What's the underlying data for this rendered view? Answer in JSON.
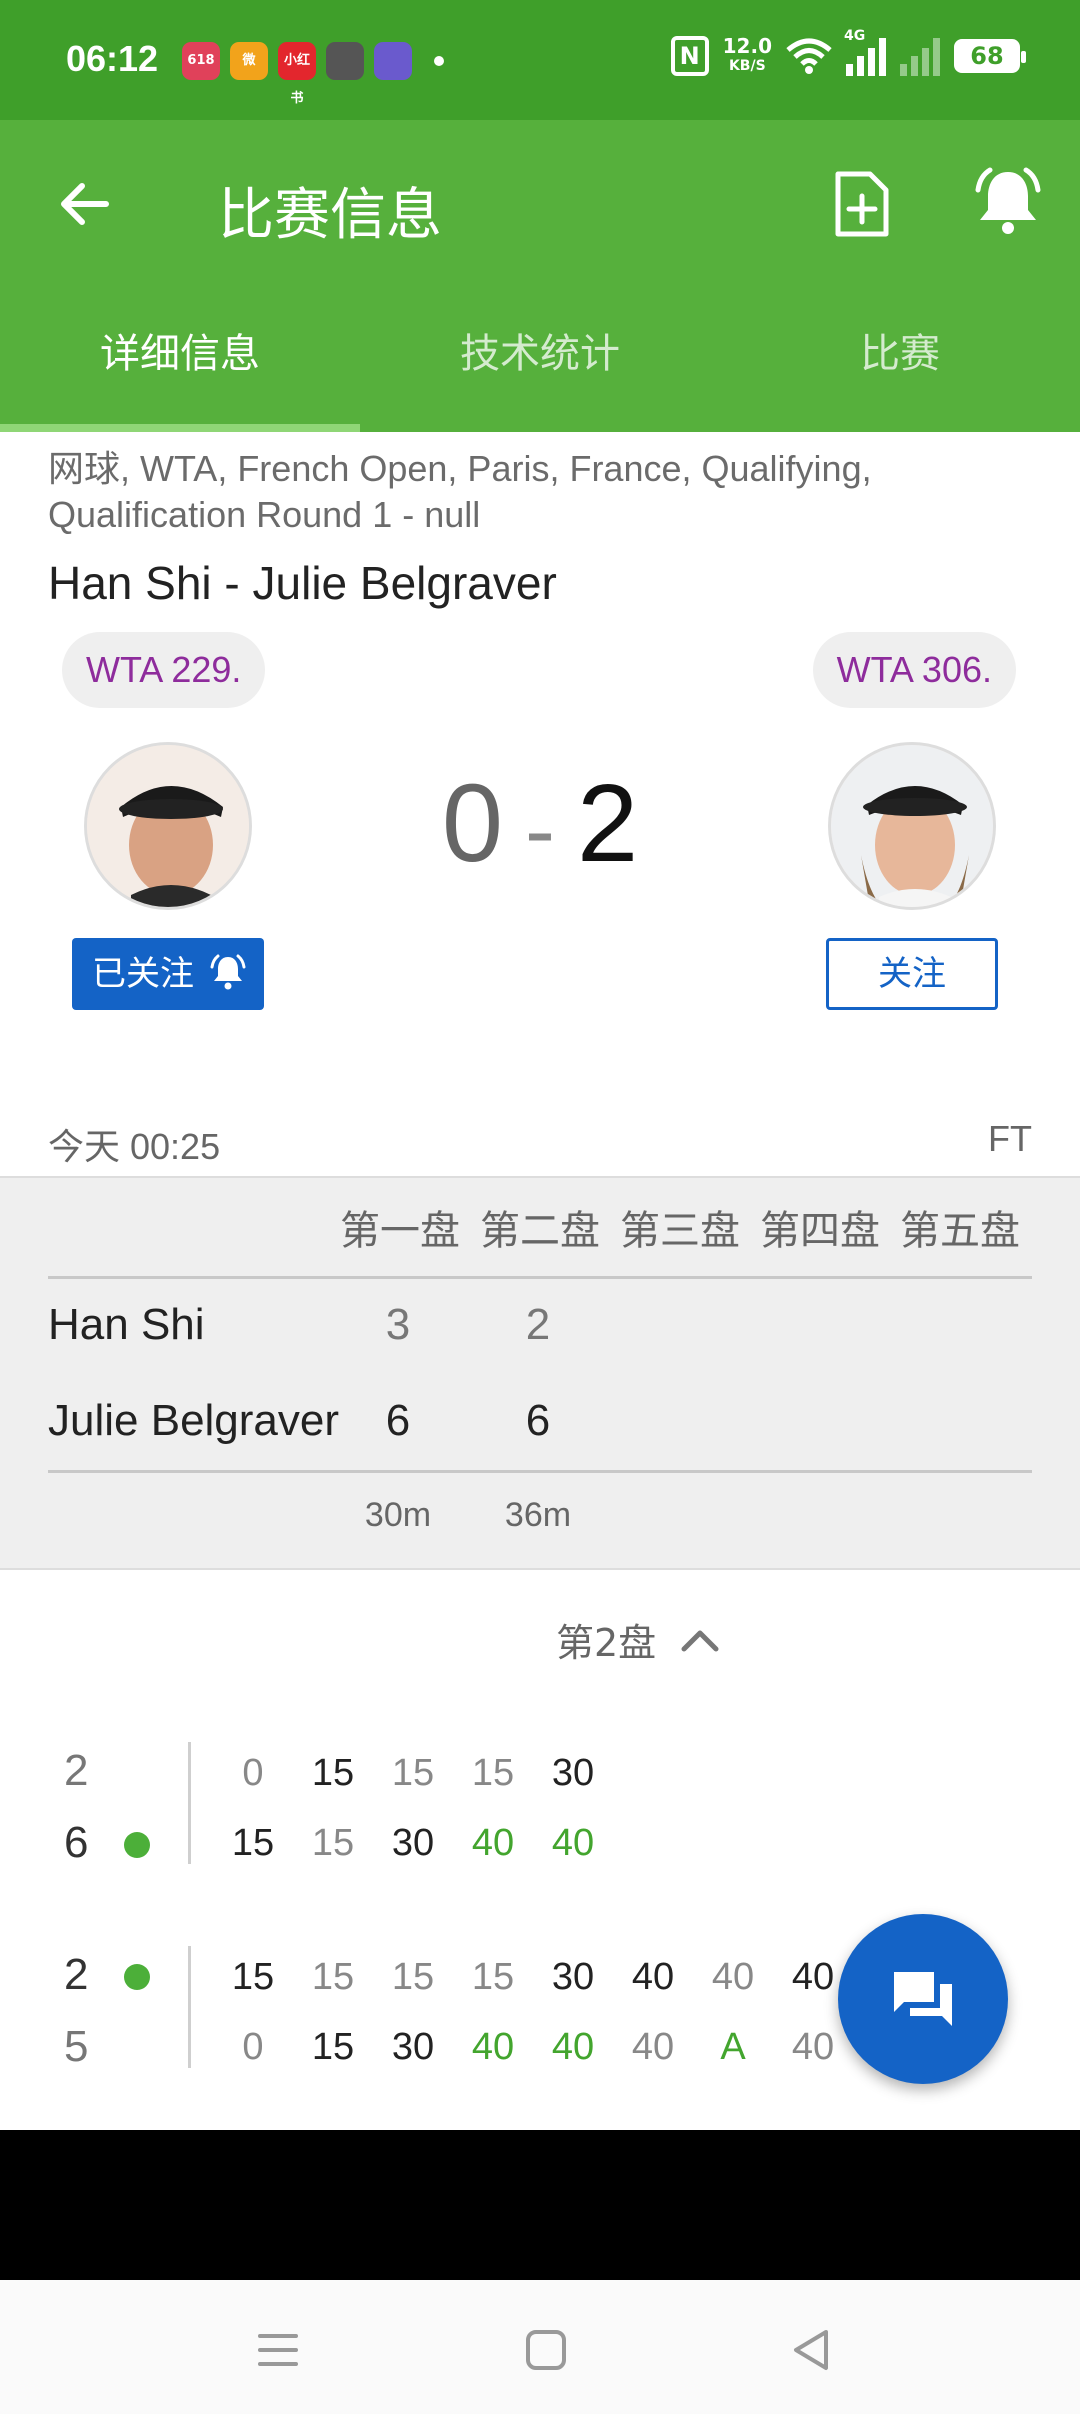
{
  "status_bar": {
    "time": "06:12",
    "app_icons": [
      {
        "name": "618-app-icon",
        "label": "618",
        "color": "#e0415a"
      },
      {
        "name": "weibo-icon",
        "label": "微",
        "color": "#f2a31b"
      },
      {
        "name": "red-app-icon",
        "label": "小红书",
        "color": "#e3262d"
      },
      {
        "name": "game-app-icon",
        "label": "",
        "color": "#555555"
      },
      {
        "name": "cartoon-app-icon",
        "label": "",
        "color": "#6a5acd"
      }
    ],
    "nfc": "N",
    "net_speed": "12.0",
    "net_speed_unit": "KB/S",
    "network": "4G",
    "battery": "68"
  },
  "app_bar": {
    "title": "比赛信息"
  },
  "tabs": [
    {
      "label": "详细信息",
      "active": true
    },
    {
      "label": "技术统计",
      "active": false
    },
    {
      "label": "比赛",
      "active": false
    }
  ],
  "match": {
    "breadcrumb": "网球, WTA, French Open, Paris, France, Qualifying, Qualification Round 1 - null",
    "title": "Han Shi - Julie Belgraver",
    "home_rank": "WTA 229.",
    "away_rank": "WTA 306.",
    "home_score": "0",
    "separator": "-",
    "away_score": "2",
    "follow_active_label": "已关注",
    "follow_label": "关注",
    "time": "今天 00:25",
    "status": "FT"
  },
  "set_table": {
    "headers": [
      "第一盘",
      "第二盘",
      "第三盘",
      "第四盘",
      "第五盘"
    ],
    "rows": [
      {
        "player": "Han Shi",
        "sets": [
          "3",
          "2"
        ]
      },
      {
        "player": "Julie Belgraver",
        "sets": [
          "6",
          "6"
        ]
      }
    ],
    "durations": [
      "30m",
      "36m"
    ]
  },
  "set_toggle": {
    "label": "第2盘"
  },
  "games": [
    {
      "home_score": "2",
      "away_score": "6",
      "server": "away",
      "home_points": [
        {
          "v": "0",
          "c": "grey"
        },
        {
          "v": "15",
          "c": "dark"
        },
        {
          "v": "15",
          "c": "grey"
        },
        {
          "v": "15",
          "c": "grey"
        },
        {
          "v": "30",
          "c": "dark"
        }
      ],
      "away_points": [
        {
          "v": "15",
          "c": "dark"
        },
        {
          "v": "15",
          "c": "grey"
        },
        {
          "v": "30",
          "c": "dark"
        },
        {
          "v": "40",
          "c": "green"
        },
        {
          "v": "40",
          "c": "green"
        }
      ]
    },
    {
      "home_score": "2",
      "away_score": "5",
      "server": "home",
      "home_points": [
        {
          "v": "15",
          "c": "dark"
        },
        {
          "v": "15",
          "c": "grey"
        },
        {
          "v": "15",
          "c": "grey"
        },
        {
          "v": "15",
          "c": "grey"
        },
        {
          "v": "30",
          "c": "dark"
        },
        {
          "v": "40",
          "c": "dark"
        },
        {
          "v": "40",
          "c": "grey"
        },
        {
          "v": "40",
          "c": "dark"
        }
      ],
      "away_points": [
        {
          "v": "0",
          "c": "grey"
        },
        {
          "v": "15",
          "c": "dark"
        },
        {
          "v": "30",
          "c": "dark"
        },
        {
          "v": "40",
          "c": "green"
        },
        {
          "v": "40",
          "c": "green"
        },
        {
          "v": "40",
          "c": "grey"
        },
        {
          "v": "A",
          "c": "green"
        },
        {
          "v": "40",
          "c": "grey"
        }
      ]
    }
  ]
}
